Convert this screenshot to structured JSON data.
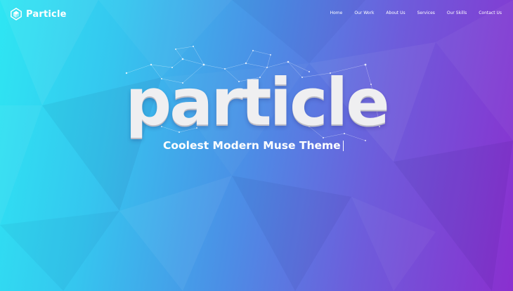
{
  "brand": {
    "name": "Particle",
    "icon": "particle-logo-icon"
  },
  "nav": {
    "items": [
      {
        "label": "Home"
      },
      {
        "label": "Our Work"
      },
      {
        "label": "About Us"
      },
      {
        "label": "Services"
      },
      {
        "label": "Our Skills"
      },
      {
        "label": "Contact Us"
      }
    ]
  },
  "hero": {
    "headline": "particle",
    "tagline": "Coolest Modern Muse Theme"
  },
  "colors": {
    "gradient_start": "#2ee6f3",
    "gradient_mid": "#4b8fe6",
    "gradient_end": "#8a2fcf",
    "headline": "#efeff1",
    "text": "#ffffff"
  }
}
